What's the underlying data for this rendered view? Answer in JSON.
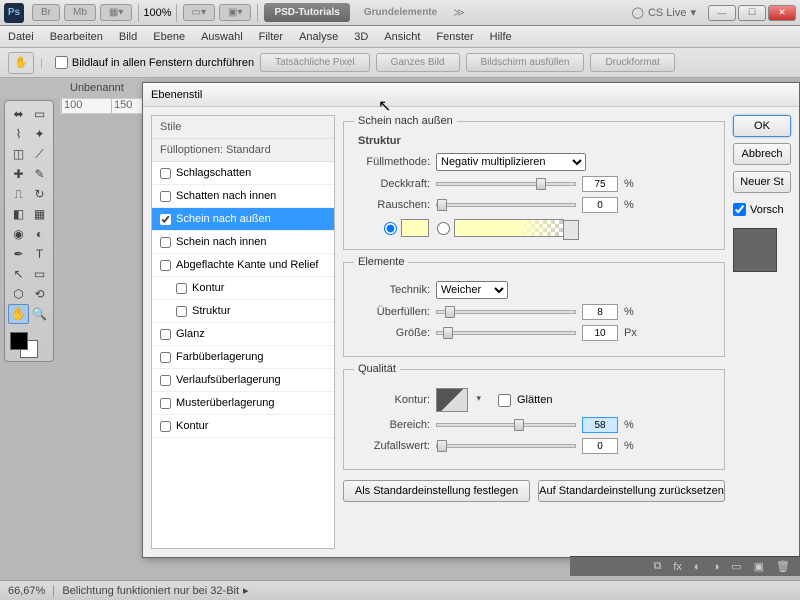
{
  "appbar": {
    "zoom": "100%",
    "tab1": "PSD-Tutorials",
    "tab2": "Grundelemente",
    "cs": "CS Live"
  },
  "menu": [
    "Datei",
    "Bearbeiten",
    "Bild",
    "Ebene",
    "Auswahl",
    "Filter",
    "Analyse",
    "3D",
    "Ansicht",
    "Fenster",
    "Hilfe"
  ],
  "optbar": {
    "scroll_all": "Bildlauf in allen Fenstern durchführen",
    "pills": [
      "Tatsächliche Pixel",
      "Ganzes Bild",
      "Bildschirm ausfüllen",
      "Druckformat"
    ]
  },
  "doc_tab": "Unbenannt",
  "ruler": [
    "100",
    "150"
  ],
  "dialog": {
    "title": "Ebenenstil",
    "styles_header": "Stile",
    "fill_header": "Fülloptionen: Standard",
    "items": [
      {
        "label": "Schlagschatten",
        "checked": false
      },
      {
        "label": "Schatten nach innen",
        "checked": false
      },
      {
        "label": "Schein nach außen",
        "checked": true,
        "selected": true
      },
      {
        "label": "Schein nach innen",
        "checked": false
      },
      {
        "label": "Abgeflachte Kante und Relief",
        "checked": false
      },
      {
        "label": "Kontur",
        "checked": false,
        "sub": true
      },
      {
        "label": "Struktur",
        "checked": false,
        "sub": true
      },
      {
        "label": "Glanz",
        "checked": false
      },
      {
        "label": "Farbüberlagerung",
        "checked": false
      },
      {
        "label": "Verlaufsüberlagerung",
        "checked": false
      },
      {
        "label": "Musterüberlagerung",
        "checked": false
      },
      {
        "label": "Kontur",
        "checked": false
      }
    ],
    "panel_title": "Schein nach außen",
    "struktur": {
      "legend": "Struktur",
      "fill_label": "Füllmethode:",
      "fill_value": "Negativ multiplizieren",
      "opacity_label": "Deckkraft:",
      "opacity_val": "75",
      "noise_label": "Rauschen:",
      "noise_val": "0"
    },
    "elemente": {
      "legend": "Elemente",
      "tech_label": "Technik:",
      "tech_value": "Weicher",
      "spread_label": "Überfüllen:",
      "spread_val": "8",
      "size_label": "Größe:",
      "size_val": "10",
      "size_unit": "Px"
    },
    "qualitaet": {
      "legend": "Qualität",
      "kontur_label": "Kontur:",
      "glaetten": "Glätten",
      "range_label": "Bereich:",
      "range_val": "58",
      "jitter_label": "Zufallswert:",
      "jitter_val": "0"
    },
    "defaults": {
      "set": "Als Standardeinstellung festlegen",
      "reset": "Auf Standardeinstellung zurücksetzen"
    },
    "btns": {
      "ok": "OK",
      "cancel": "Abbrech",
      "newstyle": "Neuer St",
      "preview": "Vorsch"
    },
    "pct": "%"
  },
  "status": {
    "zoom": "66,67%",
    "msg": "Belichtung funktioniert nur bei 32-Bit"
  }
}
